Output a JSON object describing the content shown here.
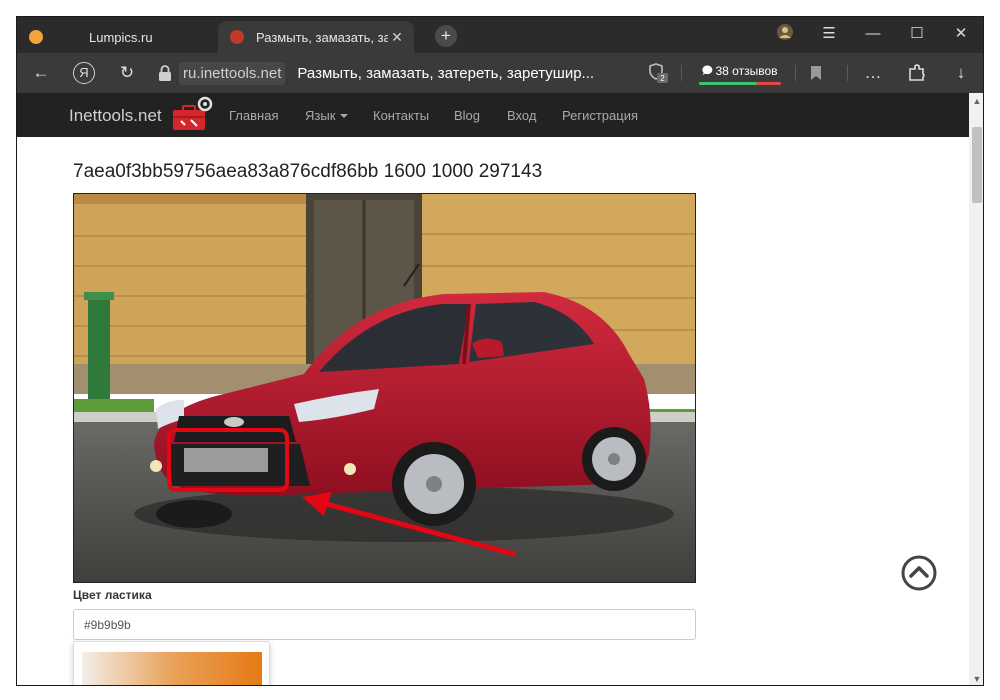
{
  "browser": {
    "tabs": [
      {
        "title": "Lumpics.ru",
        "active": false
      },
      {
        "title": "Размыть, замазать, зате",
        "active": true
      }
    ],
    "tab_close_glyph": "✕",
    "new_tab_glyph": "+",
    "address": {
      "host": "ru.inettools.net",
      "page_title": "Размыть, замазать, затереть, заретушир..."
    },
    "protect_badge": "2",
    "reviews_label": "38 отзывов",
    "window_glyphs": {
      "menu": "☰",
      "minimize": "—",
      "maximize": "☐",
      "close": "✕"
    },
    "nav_glyphs": {
      "back": "←",
      "yandex": "Я",
      "reload": "↻",
      "more": "…",
      "download": "↓"
    }
  },
  "site": {
    "brand": "Inettools.net",
    "menu": [
      "Главная",
      "Язык",
      "Контакты",
      "Blog",
      "Вход",
      "Регистрация"
    ]
  },
  "page": {
    "heading": "7aea0f3bb59756aea83a876cdf86bb 1600 1000 297143",
    "eraser_label": "Цвет ластика",
    "eraser_value": "#9b9b9b"
  },
  "colors": {
    "highlight": "#e30613",
    "car": "#b5162b",
    "eraser": "#9b9b9b"
  },
  "icons": {
    "logo": "toolbox-icon",
    "scroll_top": "chevron-up-circle-icon",
    "lock": "lock-icon",
    "shield": "shield-icon",
    "comment": "comment-icon",
    "bookmark": "bookmark-icon",
    "extensions": "extensions-icon",
    "profile": "avatar-icon"
  }
}
